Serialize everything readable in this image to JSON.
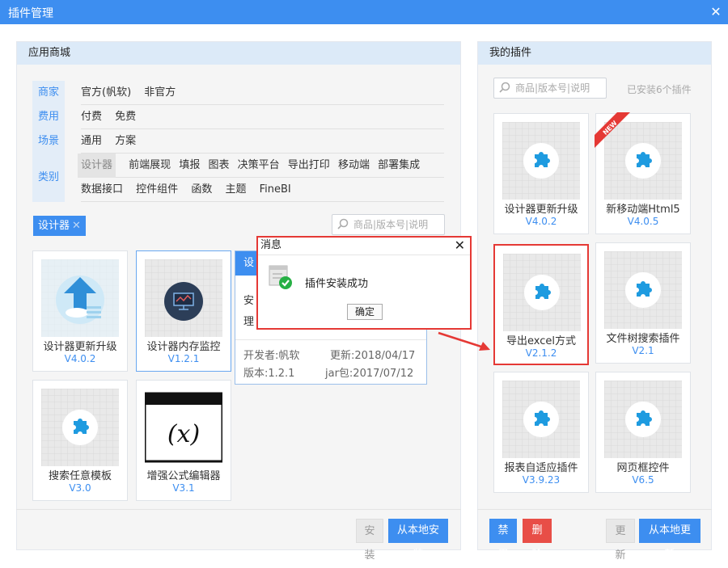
{
  "window": {
    "title": "插件管理",
    "close": "✕"
  },
  "store": {
    "header": "应用商城",
    "filters": [
      {
        "label": "商家",
        "options": [
          "官方(帆软)",
          "非官方"
        ]
      },
      {
        "label": "费用",
        "options": [
          "付费",
          "免费"
        ]
      },
      {
        "label": "场景",
        "options": [
          "通用",
          "方案"
        ]
      },
      {
        "label": "类别",
        "options_row1": [
          "设计器",
          "前端展现",
          "填报",
          "图表",
          "决策平台",
          "导出打印",
          "移动端",
          "部署集成"
        ],
        "options_row2": [
          "数据接口",
          "控件组件",
          "函数",
          "主题",
          "FineBI"
        ],
        "selected": "设计器"
      }
    ],
    "active_tag": "设计器",
    "tag_close": "✕",
    "search_placeholder": "商品|版本号|说明",
    "cards": [
      {
        "name": "设计器更新升级",
        "version": "V4.0.2"
      },
      {
        "name": "设计器内存监控",
        "version": "V1.2.1"
      },
      {
        "name": "搜索任意模板",
        "version": "V3.0"
      },
      {
        "name": "增强公式编辑器",
        "version": "V3.1"
      }
    ],
    "detail": {
      "header": "设",
      "line1": "安",
      "line2": "理",
      "developer": "开发者:帆软",
      "updated": "更新:2018/04/17",
      "version": "版本:1.2.1",
      "jar": "jar包:2017/07/12"
    },
    "buttons": {
      "install": "安装",
      "local_install": "从本地安装"
    }
  },
  "mine": {
    "header": "我的插件",
    "search_placeholder": "商品|版本号|说明",
    "installed_count": "已安装6个插件",
    "new_badge": "NEW",
    "cards": [
      {
        "name": "设计器更新升级",
        "version": "V4.0.2"
      },
      {
        "name": "新移动端Html5",
        "version": "V4.0.5"
      },
      {
        "name": "导出excel方式",
        "version": "V2.1.2"
      },
      {
        "name": "文件树搜索插件",
        "version": "V2.1"
      },
      {
        "name": "报表自适应插件",
        "version": "V3.9.23"
      },
      {
        "name": "网页框控件",
        "version": "V6.5"
      }
    ],
    "buttons": {
      "disable": "禁用",
      "delete": "删除",
      "update": "更新",
      "local_update": "从本地更新"
    }
  },
  "dialog": {
    "title": "消息",
    "close": "✕",
    "message": "插件安装成功",
    "ok": "确定"
  },
  "colors": {
    "accent": "#3d8ef0",
    "danger": "#e84e47",
    "highlight": "#e53935"
  }
}
